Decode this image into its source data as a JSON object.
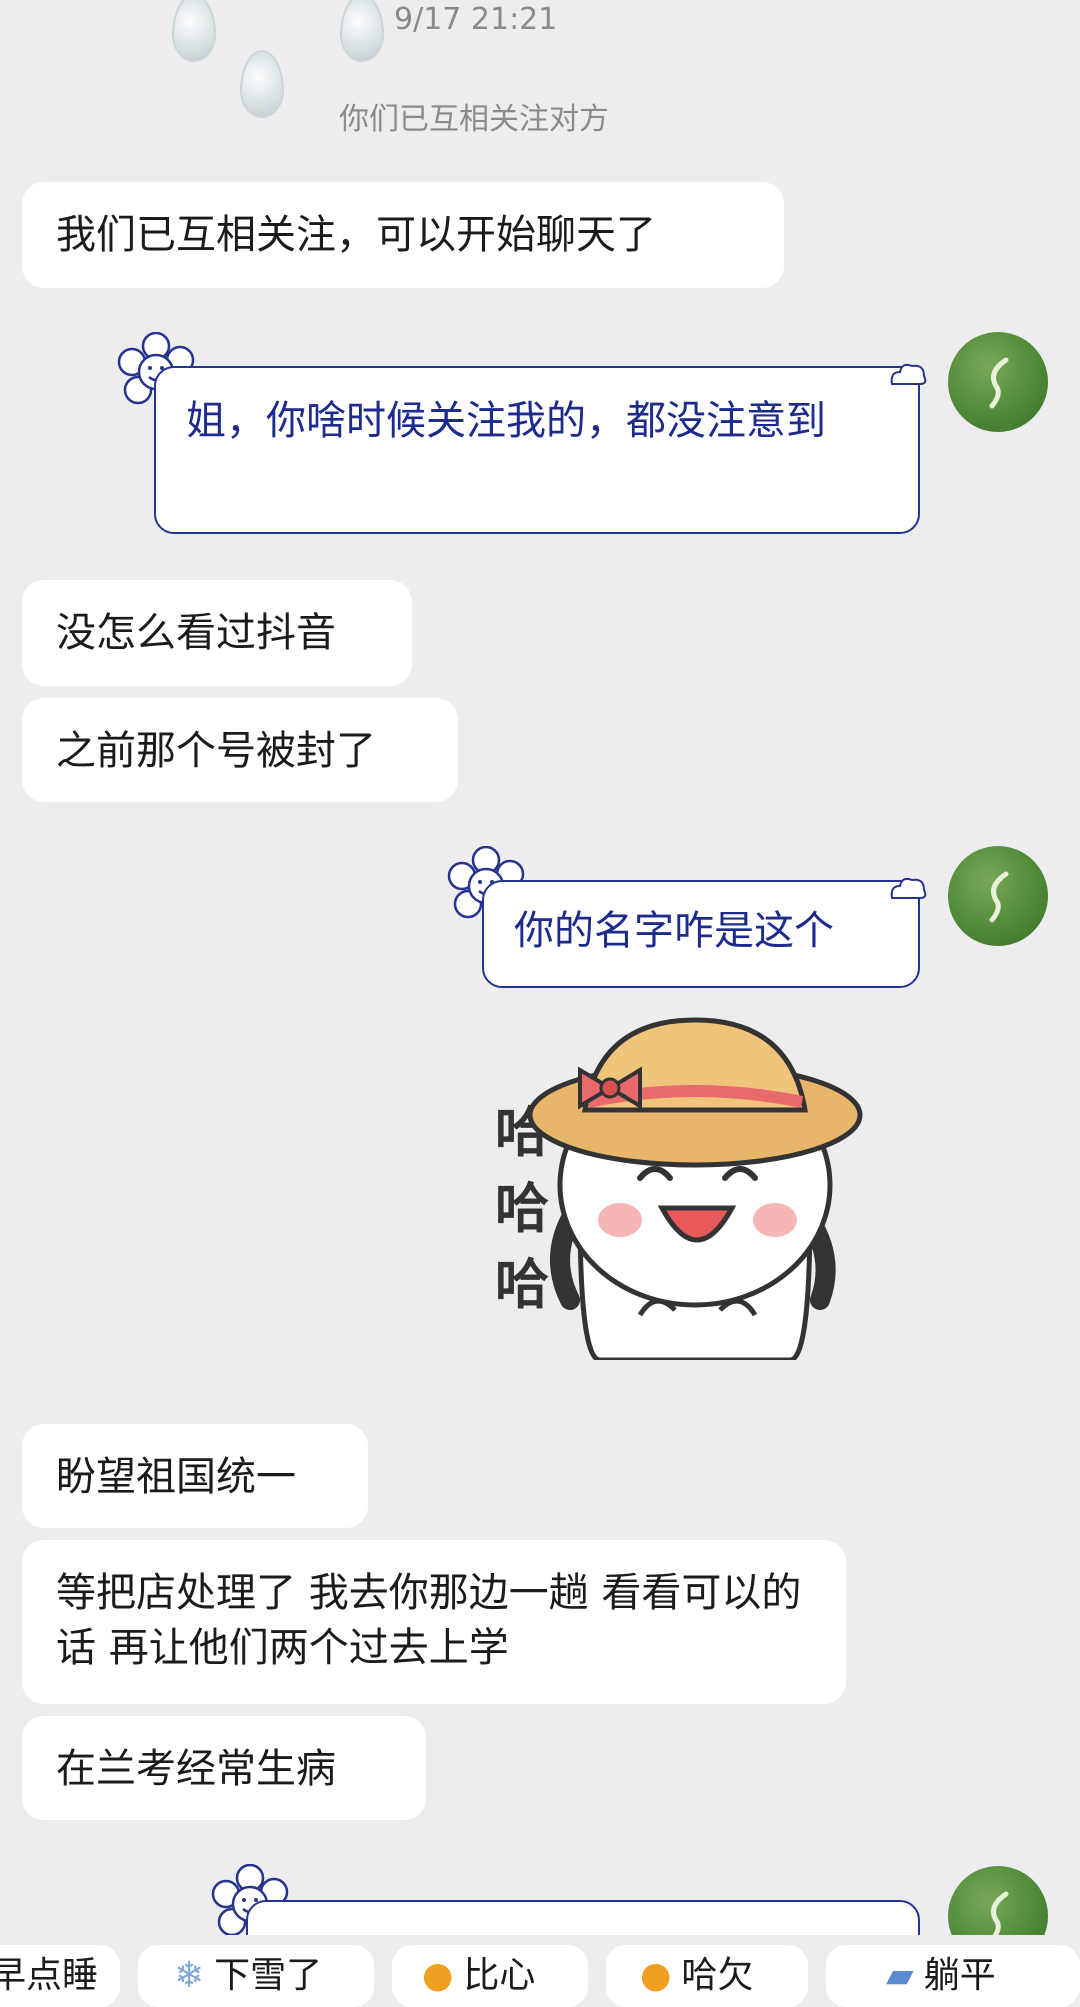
{
  "header": {
    "timestamp": "9/17 21:21",
    "system_notice": "你们已互相关注对方"
  },
  "messages": [
    {
      "side": "in",
      "text": "我们已互相关注，可以开始聊天了"
    },
    {
      "side": "out",
      "text": "姐，你啥时候关注我的，都没注意到"
    },
    {
      "side": "in",
      "text": "没怎么看过抖音"
    },
    {
      "side": "in",
      "text": "之前那个号被封了"
    },
    {
      "side": "out",
      "text": "你的名字咋是这个"
    },
    {
      "side": "out",
      "type": "sticker",
      "text": "哈哈哈"
    },
    {
      "side": "in",
      "text": "盼望祖国统一"
    },
    {
      "side": "in",
      "text": "等把店处理了 我去你那边一趟  看看可以的话 再让他们两个过去上学"
    },
    {
      "side": "in",
      "text": "在兰考经常生病"
    }
  ],
  "quick_replies": [
    {
      "label": "早点睡",
      "icon": "moon-icon"
    },
    {
      "label": "下雪了",
      "icon": "snowflake-icon"
    },
    {
      "label": "比心",
      "icon": "heart-hands-icon"
    },
    {
      "label": "哈欠",
      "icon": "yawn-icon"
    },
    {
      "label": "躺平",
      "icon": "lying-icon"
    }
  ],
  "colors": {
    "background": "#ededef",
    "outgoing_border": "#26348f",
    "outgoing_text": "#1d2a8e",
    "incoming_bubble": "#ffffff",
    "meta_text": "#8a8a8a"
  }
}
